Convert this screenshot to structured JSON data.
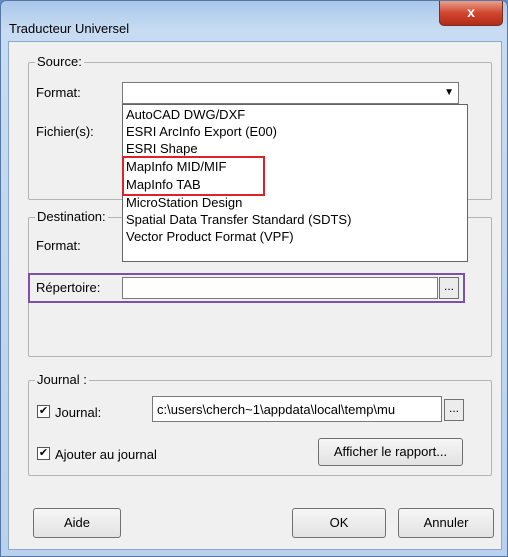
{
  "window": {
    "title": "Traducteur Universel",
    "close_glyph": "x"
  },
  "source": {
    "group_label": "Source:",
    "format_label": "Format:",
    "files_label": "Fichier(s):",
    "dropdown_arrow": "▼",
    "format_options": [
      "AutoCAD DWG/DXF",
      "ESRI ArcInfo Export (E00)",
      "ESRI Shape",
      "MapInfo MID/MIF",
      "MapInfo TAB",
      "MicroStation Design",
      "Spatial Data Transfer Standard (SDTS)",
      "Vector Product Format (VPF)"
    ]
  },
  "destination": {
    "group_label": "Destination:",
    "format_label": "Format:",
    "directory_label": "Répertoire:",
    "browse_label": "..."
  },
  "journal": {
    "group_label": "Journal :",
    "journal_checkbox_label": "Journal:",
    "journal_checked": true,
    "journal_path": "c:\\users\\cherch~1\\appdata\\local\\temp\\mu",
    "browse_label": "...",
    "append_label": "Ajouter au journal",
    "append_checked": true,
    "show_report_button": "Afficher le rapport...",
    "check_mark": "✔"
  },
  "buttons": {
    "help": "Aide",
    "ok": "OK",
    "cancel": "Annuler"
  },
  "colors": {
    "highlight_red": "#d9252a",
    "focus_purple": "#7f4fb0",
    "close_red": "#c8402b"
  }
}
